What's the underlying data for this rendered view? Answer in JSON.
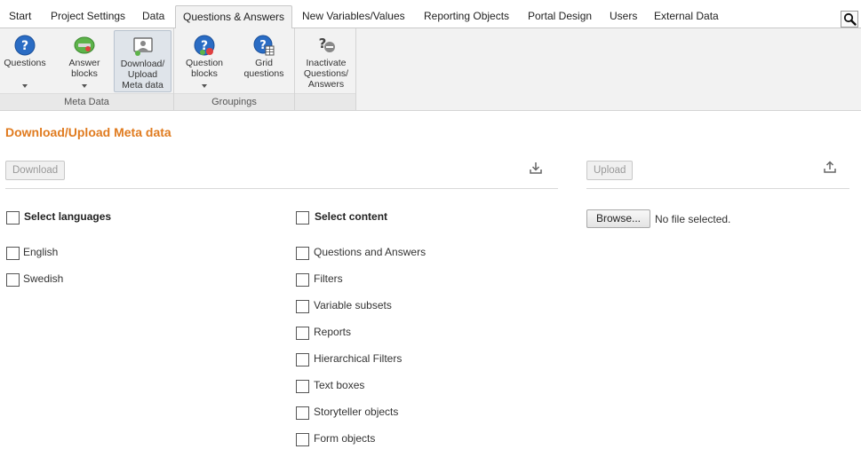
{
  "tabs": [
    {
      "label": "Start",
      "active": false
    },
    {
      "label": "Project Settings",
      "active": false
    },
    {
      "label": "Data",
      "active": false
    },
    {
      "label": "Questions & Answers",
      "active": true
    },
    {
      "label": "New Variables/Values",
      "active": false
    },
    {
      "label": "Reporting Objects",
      "active": false
    },
    {
      "label": "Portal Design",
      "active": false
    },
    {
      "label": "Users",
      "active": false
    },
    {
      "label": "External Data",
      "active": false
    }
  ],
  "search_icon": "magnifier-icon",
  "ribbon": {
    "groups": [
      {
        "label": "Meta Data",
        "buttons": [
          {
            "label": "Questions",
            "icon": "question-circle-icon",
            "has_dropdown": true
          },
          {
            "label": "Answer\nblocks",
            "icon": "answer-blocks-icon",
            "has_dropdown": true
          },
          {
            "label": "Download/\nUpload\nMeta data",
            "icon": "download-upload-icon",
            "has_dropdown": false,
            "selected": true
          }
        ]
      },
      {
        "label": "Groupings",
        "buttons": [
          {
            "label": "Question\nblocks",
            "icon": "question-blocks-icon",
            "has_dropdown": true
          },
          {
            "label": "Grid\nquestions",
            "icon": "grid-questions-icon",
            "has_dropdown": false
          }
        ]
      },
      {
        "label": "",
        "buttons": [
          {
            "label": "Inactivate\nQuestions/\nAnswers",
            "icon": "inactivate-icon",
            "has_dropdown": false
          }
        ]
      }
    ]
  },
  "main": {
    "title": "Download/Upload Meta data",
    "download_button": "Download",
    "upload_button": "Upload",
    "languages": {
      "header": "Select languages",
      "items": [
        "English",
        "Swedish"
      ]
    },
    "content": {
      "header": "Select content",
      "items": [
        "Questions and Answers",
        "Filters",
        "Variable subsets",
        "Reports",
        "Hierarchical Filters",
        "Text boxes",
        "Storyteller objects",
        "Form objects"
      ]
    },
    "browse_button": "Browse...",
    "file_status": "No file selected."
  },
  "colors": {
    "accent_title": "#e07b1f",
    "icon_blue": "#2a6cc4",
    "icon_green": "#5db34a",
    "ribbon_bg": "#f2f2f2"
  }
}
